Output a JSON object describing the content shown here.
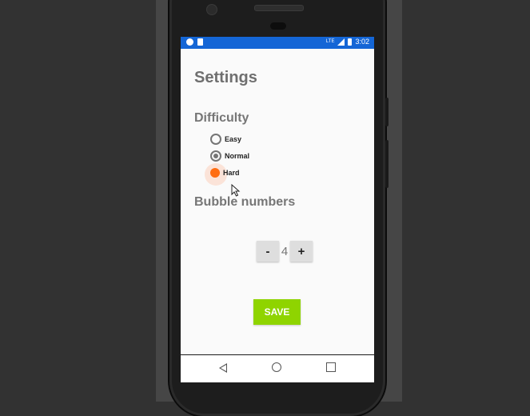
{
  "statusbar": {
    "time": "3:02",
    "network": "LTE"
  },
  "settings": {
    "title": "Settings",
    "difficulty": {
      "heading": "Difficulty",
      "options": [
        {
          "label": "Easy",
          "checked": false
        },
        {
          "label": "Normal",
          "checked": true
        },
        {
          "label": "Hard",
          "checked": false,
          "pressed": true
        }
      ]
    },
    "bubbles": {
      "heading": "Bubble numbers",
      "decrement_label": "-",
      "value": "4",
      "increment_label": "+"
    },
    "save_label": "SAVE"
  },
  "colors": {
    "statusbar": "#1466d6",
    "save_button": "#8fd400",
    "pressed_radio": "#ff6d12"
  },
  "icons": [
    "dot-icon",
    "sd-card-icon",
    "lte-icon",
    "signal-icon",
    "battery-icon",
    "nav-back-icon",
    "nav-home-icon",
    "nav-recents-icon",
    "cursor-icon"
  ]
}
